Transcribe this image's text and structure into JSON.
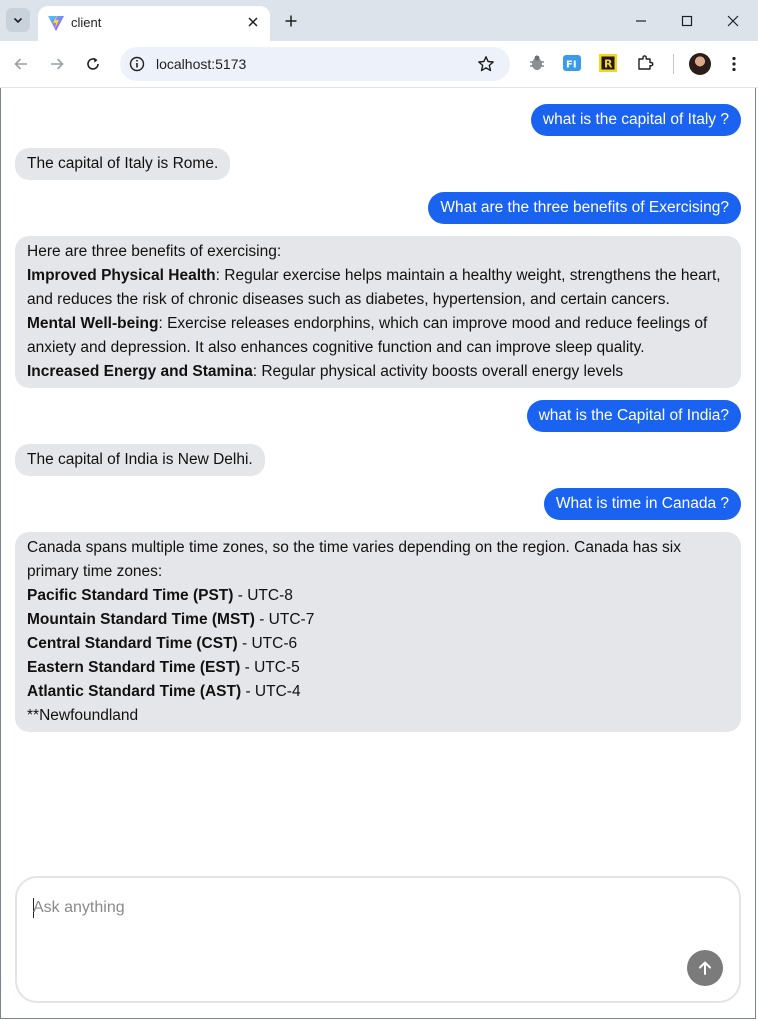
{
  "browser": {
    "tab_title": "client",
    "url": "localhost:5173"
  },
  "chat": {
    "messages": [
      {
        "role": "user",
        "text": "what is the capital of Italy ?"
      },
      {
        "role": "assistant",
        "text": "The capital of Italy is Rome."
      },
      {
        "role": "user",
        "text": "What are the three benefits of Exercising?"
      },
      {
        "role": "assistant",
        "intro": "Here are three benefits of exercising:",
        "items": [
          {
            "bold": "Improved Physical Health",
            "rest": ": Regular exercise helps maintain a healthy weight, strengthens the heart, and reduces the risk of chronic diseases such as diabetes, hypertension, and certain cancers."
          },
          {
            "bold": "Mental Well-being",
            "rest": ": Exercise releases endorphins, which can improve mood and reduce feelings of anxiety and depression. It also enhances cognitive function and can improve sleep quality."
          },
          {
            "bold": "Increased Energy and Stamina",
            "rest": ": Regular physical activity boosts overall energy levels"
          }
        ]
      },
      {
        "role": "user",
        "text": "what is the Capital of India?"
      },
      {
        "role": "assistant",
        "text": "The capital of India is New Delhi."
      },
      {
        "role": "user",
        "text": "What is time in Canada ?"
      },
      {
        "role": "assistant",
        "intro": "Canada spans multiple time zones, so the time varies depending on the region. Canada has six primary time zones:",
        "items": [
          {
            "bold": "Pacific Standard Time (PST)",
            "rest": " - UTC-8"
          },
          {
            "bold": "Mountain Standard Time (MST)",
            "rest": " - UTC-7"
          },
          {
            "bold": "Central Standard Time (CST)",
            "rest": " - UTC-6"
          },
          {
            "bold": "Eastern Standard Time (EST)",
            "rest": " - UTC-5"
          },
          {
            "bold": "Atlantic Standard Time (AST)",
            "rest": " - UTC-4"
          }
        ],
        "outro": "**Newfoundland"
      }
    ]
  },
  "composer": {
    "placeholder": "Ask anything",
    "send_icon": "arrow-up-icon"
  },
  "icons": {
    "tab_search": "chevron-down-icon",
    "favicon": "vite-logo-icon",
    "close": "close-icon",
    "new_tab": "plus-icon",
    "back": "back-arrow-icon",
    "forward": "forward-arrow-icon",
    "reload": "reload-icon",
    "info": "site-info-icon",
    "bookmark": "star-icon",
    "extensions": [
      "bug-extension-icon",
      "fi-extension-icon",
      "r-extension-icon",
      "puzzle-extensions-icon"
    ],
    "menu": "more-vertical-icon"
  },
  "colors": {
    "user_bubble": "#1a63f0",
    "assistant_bubble": "#e5e6ea",
    "send_button": "#7b7b7b"
  }
}
